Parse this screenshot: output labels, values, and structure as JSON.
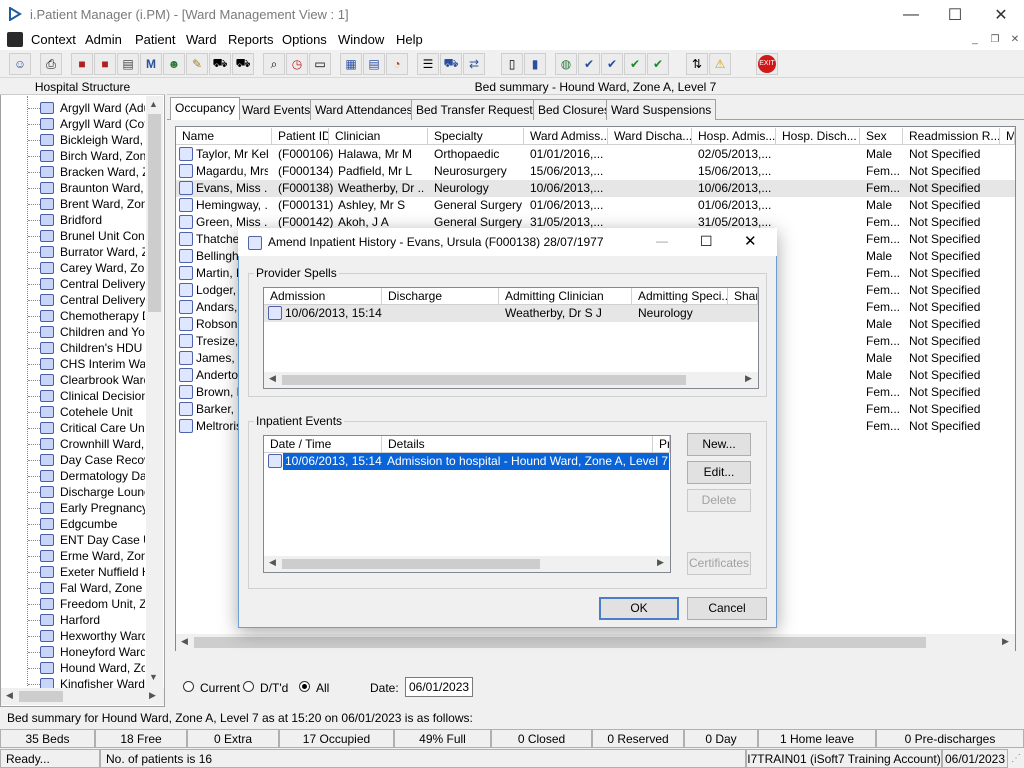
{
  "window": {
    "title": "i.Patient Manager (i.PM) - [Ward Management View : 1]",
    "minimize": "—",
    "maximize": "☐",
    "close": "✕"
  },
  "menu": [
    "Context",
    "Admin",
    "Patient",
    "Ward",
    "Reports",
    "Options",
    "Window",
    "Help"
  ],
  "mdi_controls": {
    "minimize": "_",
    "restore": "❐",
    "close": "✕"
  },
  "toolbar_icons": [
    "patient-icon",
    "printer-icon",
    "book-icon",
    "book-add-icon",
    "folder-icon",
    "m-icon",
    "person-icon",
    "note-icon",
    "ambulance-icon",
    "ambulance2-icon",
    "search-icon",
    "clock-icon",
    "monitor-icon",
    "chart-icon",
    "document-icon",
    "gauge-icon",
    "list-icon",
    "bed-icon",
    "bed-transfer-icon",
    "page-icon",
    "bar-chart-icon",
    "globe-icon",
    "check-icon",
    "check2-icon",
    "green-check-icon",
    "green-check2-icon",
    "swap-icon",
    "warning-icon",
    "exit-icon"
  ],
  "left_panel": {
    "heading": "Hospital Structure",
    "wards": [
      "Argyll Ward (Adul",
      "Argyll Ward (Cots",
      "Bickleigh Ward, Z",
      "Birch Ward, Zone",
      "Bracken Ward, Z",
      "Braunton Ward, Z",
      "Brent Ward, Zone",
      "Bridford",
      "Brunel Unit Conti",
      "Burrator Ward, Z",
      "Carey Ward, Zon",
      "Central Delivery S",
      "Central Delivery S",
      "Chemotherapy D",
      "Children and You",
      "Children's HDU (",
      "CHS Interim Ward",
      "Clearbrook Ward",
      "Clinical Decision",
      "Cotehele Unit",
      "Critical Care Unit",
      "Crownhill Ward, Z",
      "Day Case Recov",
      "Dermatology Day",
      "Discharge Loung",
      "Early Pregnancy",
      "Edgcumbe",
      "ENT Day Case U",
      "Erme Ward, Zone",
      "Exeter Nuffield H",
      "Fal Ward, Zone E",
      "Freedom Unit, Zo",
      "Harford",
      "Hexworthy Ward,",
      "Honeyford Ward,",
      "Hound Ward, Zo",
      "Kingfisher Ward"
    ]
  },
  "summary_heading": "Bed summary - Hound Ward, Zone A, Level 7",
  "tabs": [
    "Occupancy",
    "Ward Events",
    "Ward Attendances",
    "Bed Transfer Requests",
    "Bed Closures",
    "Ward Suspensions"
  ],
  "grid": {
    "columns": [
      "Name",
      "Patient ID",
      "Clinician",
      "Specialty",
      "Ward Admiss...",
      "Ward Discha...",
      "Hosp. Admis...",
      "Hosp. Disch...",
      "Sex",
      "Readmission R...",
      "M"
    ],
    "rows": [
      {
        "name": "Taylor, Mr Kel...",
        "id": "(F000106)",
        "clin": "Halawa, Mr M",
        "spec": "Orthopaedic",
        "wadm": "01/01/2016,...",
        "hadm": "02/05/2013,...",
        "sex": "Male",
        "readm": "Not Specified"
      },
      {
        "name": "Magardu, Mrs...",
        "id": "(F000134)",
        "clin": "Padfield, Mr L",
        "spec": "Neurosurgery",
        "wadm": "15/06/2013,...",
        "hadm": "15/06/2013,...",
        "sex": "Fem...",
        "readm": "Not Specified"
      },
      {
        "name": "Evans, Miss ...",
        "id": "(F000138)",
        "clin": "Weatherby, Dr ...",
        "spec": "Neurology",
        "wadm": "10/06/2013,...",
        "hadm": "10/06/2013,...",
        "sex": "Fem...",
        "readm": "Not Specified"
      },
      {
        "name": "Hemingway, ...",
        "id": "(F000131)",
        "clin": "Ashley, Mr S",
        "spec": "General Surgery",
        "wadm": "01/06/2013,...",
        "hadm": "01/06/2013,...",
        "sex": "Male",
        "readm": "Not Specified"
      },
      {
        "name": "Green, Miss ...",
        "id": "(F000142)",
        "clin": "Akoh, J A",
        "spec": "General Surgery",
        "wadm": "31/05/2013,...",
        "hadm": "31/05/2013,...",
        "sex": "Fem...",
        "readm": "Not Specified"
      },
      {
        "name": "Thatcher",
        "sex": "Fem...",
        "readm": "Not Specified"
      },
      {
        "name": "Bellingha",
        "sex": "Male",
        "readm": "Not Specified"
      },
      {
        "name": "Martin, M",
        "sex": "Fem...",
        "readm": "Not Specified"
      },
      {
        "name": "Lodger, A",
        "sex": "Fem...",
        "readm": "Not Specified"
      },
      {
        "name": "Andars, M",
        "sex": "Fem...",
        "readm": "Not Specified"
      },
      {
        "name": "Robson, L",
        "sex": "Male",
        "readm": "Not Specified"
      },
      {
        "name": "Tresize, L",
        "sex": "Fem...",
        "readm": "Not Specified"
      },
      {
        "name": "James, M",
        "sex": "Male",
        "readm": "Not Specified"
      },
      {
        "name": "Anderton",
        "sex": "Male",
        "readm": "Not Specified"
      },
      {
        "name": "Brown, M",
        "sex": "Fem...",
        "readm": "Not Specified"
      },
      {
        "name": "Barker, M",
        "sex": "Fem...",
        "readm": "Not Specified"
      },
      {
        "name": "Meltrorisk",
        "sex": "Fem...",
        "readm": "Not Specified"
      }
    ]
  },
  "filters": {
    "current": "Current",
    "dtd": "D/T'd",
    "all": "All",
    "date_label": "Date:",
    "date_value": "06/01/2023"
  },
  "dialog": {
    "title": "Amend Inpatient History - Evans, Ursula (F000138) 28/07/1977",
    "provider_spells_label": "Provider Spells",
    "spell_columns": [
      "Admission",
      "Discharge",
      "Admitting Clinician",
      "Admitting Speci...",
      "Shar"
    ],
    "spell_row": {
      "admission": "10/06/2013, 15:14",
      "discharge": "",
      "clinician": "Weatherby, Dr S J",
      "specialty": "Neurology"
    },
    "inpatient_events_label": "Inpatient Events",
    "event_columns": [
      "Date / Time",
      "Details",
      "Pr"
    ],
    "event_row": {
      "datetime": "10/06/2013, 15:14",
      "details": "Admission to hospital - Hound Ward, Zone A, Level 7"
    },
    "new_button": "New...",
    "edit_button": "Edit...",
    "delete_button": "Delete",
    "certificates_button": "Certificates",
    "ok_button": "OK",
    "cancel_button": "Cancel"
  },
  "summary_line": "Bed summary for Hound Ward, Zone A, Level 7 as at 15:20 on 06/01/2023 is as follows:",
  "stats": [
    "35 Beds",
    "18 Free",
    "0 Extra",
    "17 Occupied",
    "49% Full",
    "0 Closed",
    "0 Reserved",
    "0 Day",
    "1 Home leave",
    "0 Pre-discharges"
  ],
  "status": {
    "ready": "Ready...",
    "patients": "No. of patients is 16",
    "account": "I7TRAIN01 (iSoft7 Training Account)",
    "date": "06/01/2023"
  }
}
